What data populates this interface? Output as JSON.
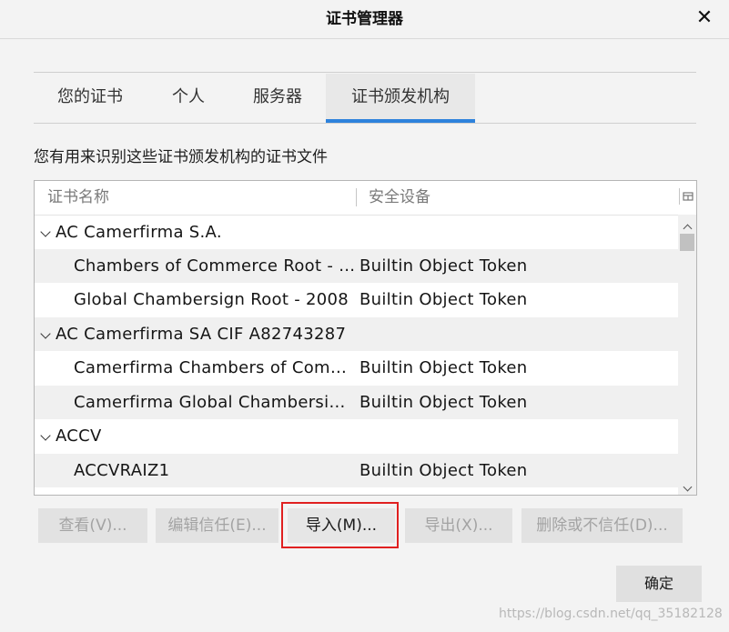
{
  "dialog": {
    "title": "证书管理器",
    "close_glyph": "✕"
  },
  "tabs": [
    {
      "label": "您的证书",
      "active": false
    },
    {
      "label": "个人",
      "active": false
    },
    {
      "label": "服务器",
      "active": false
    },
    {
      "label": "证书颁发机构",
      "active": true
    }
  ],
  "description": "您有用来识别这些证书颁发机构的证书文件",
  "list": {
    "columns": [
      "证书名称",
      "安全设备"
    ],
    "rows": [
      {
        "type": "group",
        "name": "AC Camerfirma S.A.",
        "device": ""
      },
      {
        "type": "cert",
        "name": "Chambers of Commerce Root - …",
        "device": "Builtin Object Token"
      },
      {
        "type": "cert",
        "name": "Global Chambersign Root - 2008",
        "device": "Builtin Object Token"
      },
      {
        "type": "group",
        "name": "AC Camerfirma SA CIF A82743287",
        "device": ""
      },
      {
        "type": "cert",
        "name": "Camerfirma Chambers of Com…",
        "device": "Builtin Object Token"
      },
      {
        "type": "cert",
        "name": "Camerfirma Global Chambersig…",
        "device": "Builtin Object Token"
      },
      {
        "type": "group",
        "name": "ACCV",
        "device": ""
      },
      {
        "type": "cert",
        "name": "ACCVRAIZ1",
        "device": "Builtin Object Token"
      }
    ]
  },
  "buttons": {
    "view": "查看(V)...",
    "edit_trust": "编辑信任(E)...",
    "import": "导入(M)...",
    "export": "导出(X)...",
    "delete_distrust": "删除或不信任(D)...",
    "ok": "确定"
  },
  "watermark": "https://blog.csdn.net/qq_35182128",
  "colors": {
    "accent": "#2d82dc",
    "highlight_border": "#e02020"
  }
}
